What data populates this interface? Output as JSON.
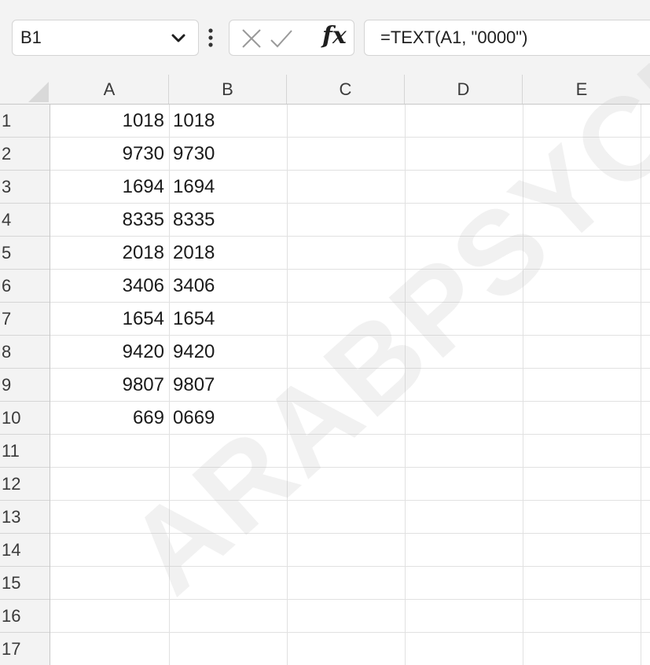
{
  "formula_bar": {
    "name_box": "B1",
    "formula": "=TEXT(A1, \"0000\")",
    "icons": {
      "name_box_dropdown": "chevron-down-icon",
      "more": "vertical-ellipsis-icon",
      "cancel": "cancel-x-icon",
      "enter": "checkmark-icon",
      "insert_function": "fx-icon"
    },
    "fx_label": "fx"
  },
  "grid": {
    "columns": [
      "A",
      "B",
      "C",
      "D",
      "E"
    ],
    "rows": [
      "1",
      "2",
      "3",
      "4",
      "5",
      "6",
      "7",
      "8",
      "9",
      "10",
      "11",
      "12",
      "13",
      "14",
      "15",
      "16",
      "17"
    ],
    "cells": {
      "A": [
        "1018",
        "9730",
        "1694",
        "8335",
        "2018",
        "3406",
        "1654",
        "9420",
        "9807",
        "669"
      ],
      "B": [
        "1018",
        "9730",
        "1694",
        "8335",
        "2018",
        "3406",
        "1654",
        "9420",
        "9807",
        "0669"
      ]
    }
  },
  "watermark": "ARABPSYCHOL",
  "colors": {
    "header_bg": "#f3f3f3",
    "gridline": "#e1e1e1",
    "text": "#1a1a1a"
  }
}
